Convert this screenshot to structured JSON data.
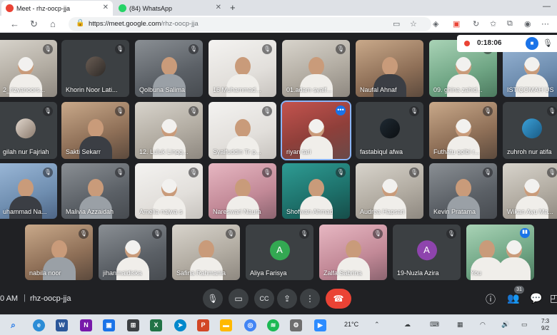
{
  "browser": {
    "tabs": [
      {
        "title": "Meet - rhz-oocp-jja",
        "active": true,
        "favicon_color": "#ea4335"
      },
      {
        "title": "(84) WhatsApp",
        "active": false,
        "favicon_color": "#25d366"
      }
    ],
    "url_host": "https://meet.google.com",
    "url_path": "/rhz-oocp-jja"
  },
  "recording": {
    "time": "0:18:06"
  },
  "participants": [
    {
      "name": "2_rizyanoors...",
      "muted": true
    },
    {
      "name": "Khorin Noor Lati...",
      "muted": true
    },
    {
      "name": "Qolbuna Salima",
      "muted": true
    },
    {
      "name": "16 Muhammad...",
      "muted": true
    },
    {
      "name": "01.adam syaif...",
      "muted": true
    },
    {
      "name": "Naufal Ahnaf",
      "muted": true
    },
    {
      "name": "09. ghina zahid...",
      "muted": true
    },
    {
      "name": "ISTIQOMAH US",
      "muted": true
    },
    {
      "name": "gilah nur Fajriah",
      "muted": true
    },
    {
      "name": "Sakti Sekarr",
      "muted": true
    },
    {
      "name": "12. Luluk Lingg...",
      "muted": true
    },
    {
      "name": "Syaifuddin Tr p...",
      "muted": true
    },
    {
      "name": "riyan tari",
      "muted": false
    },
    {
      "name": "fastabiqul afwa",
      "muted": true
    },
    {
      "name": "Futhatu qolbi r...",
      "muted": true
    },
    {
      "name": "zuhroh nur atifa",
      "muted": true
    },
    {
      "name": "uhammad Na...",
      "muted": true
    },
    {
      "name": "Malivia Azzaidah",
      "muted": true
    },
    {
      "name": "Amelia najwa s",
      "muted": true
    },
    {
      "name": "Nareswari Naura",
      "muted": true
    },
    {
      "name": "Shofwan Ahmad",
      "muted": true
    },
    {
      "name": "Audrea Hapsari",
      "muted": true
    },
    {
      "name": "Kevin Pratama",
      "muted": true
    },
    {
      "name": "Wikan Ayu Ma...",
      "muted": true
    },
    {
      "name": "nabila noor",
      "muted": true
    },
    {
      "name": "jihanmaidiska",
      "muted": true
    },
    {
      "name": "Safina Rahmania",
      "muted": true
    },
    {
      "name": "Aliya Farisya",
      "muted": true,
      "initial": "A",
      "avatar_color": "#33a852"
    },
    {
      "name": "Zalfa Sabrina",
      "muted": true
    },
    {
      "name": "19-Nuzla Azira",
      "muted": true,
      "initial": "A",
      "avatar_color": "#8e44ad"
    },
    {
      "name": "You",
      "muted": false
    }
  ],
  "controls": {
    "clock": "0 AM",
    "meeting_code": "rhz-oocp-jja",
    "participant_count": "31"
  },
  "taskbar": {
    "weather": "21°C",
    "time": "7:3",
    "date": "9/2"
  }
}
